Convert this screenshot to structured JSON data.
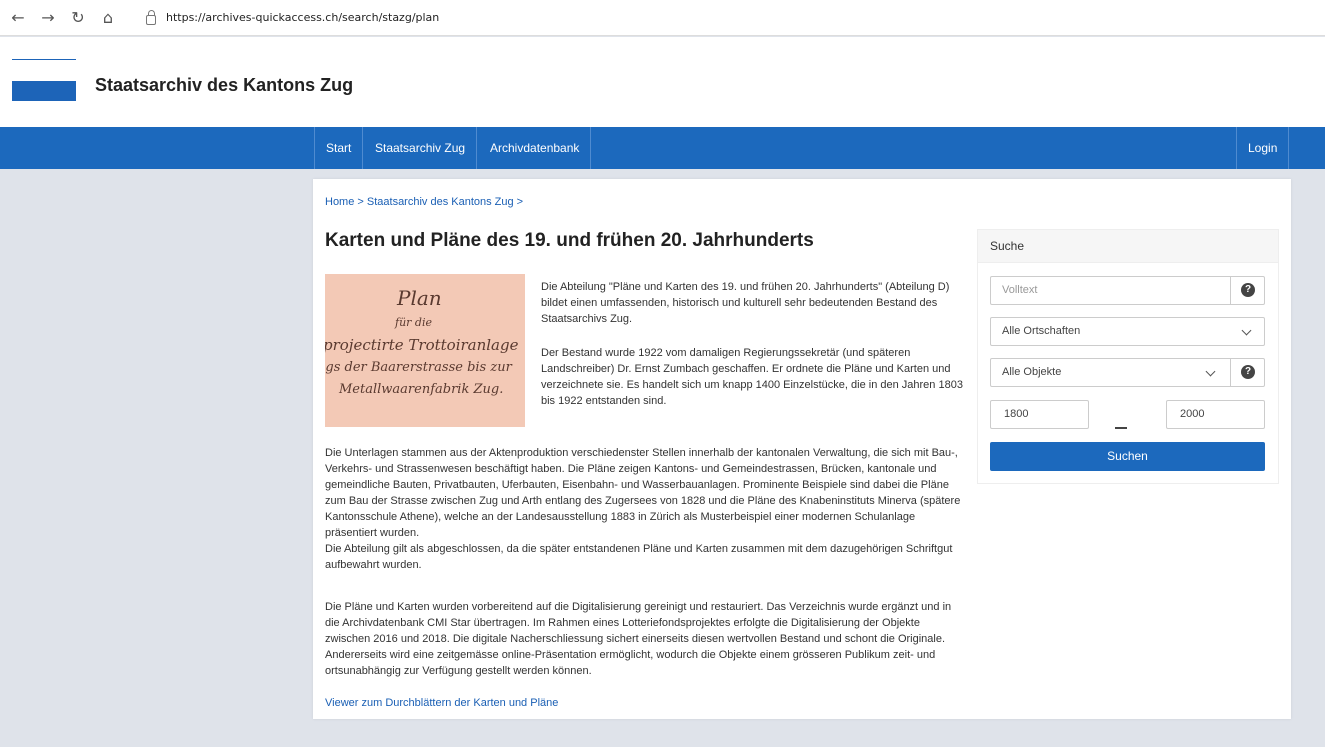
{
  "browser": {
    "back": "←",
    "forward": "→",
    "reload": "↻",
    "home": "⌂",
    "url": "https://archives-quickaccess.ch/search/stazg/plan"
  },
  "site": {
    "title": "Staatsarchiv des Kantons Zug",
    "accent_color": "#1c69bd"
  },
  "nav": {
    "items": [
      "Start",
      "Staatsarchiv Zug",
      "Archivdatenbank"
    ],
    "login": "Login"
  },
  "main": {
    "breadcrumb": "Home > Staatsarchiv des Kantons Zug >",
    "title": "Karten und Pläne des 19. und frühen 20. Jahrhunderts",
    "image_lines": [
      "Plan",
      "für die",
      "projectirte Trottoiranlage",
      "ngs der Baarerstrasse bis zur",
      "Metallwaarenfabrik Zug."
    ],
    "intro_1": "Die Abteilung \"Pläne und Karten des 19. und frühen 20. Jahrhunderts\" (Abteilung D) bildet einen umfassenden, historisch und kulturell sehr bedeutenden Bestand des Staatsarchivs Zug.",
    "intro_2": "Der Bestand wurde 1922 vom damaligen Regierungssekretär (und späteren Landschreiber) Dr. Ernst Zumbach geschaffen. Er ordnete die Pläne und Karten und verzeichnete sie. Es handelt sich um knapp 1400 Einzelstücke, die in den Jahren 1803 bis 1922 entstanden sind.",
    "body_1": "Die Unterlagen stammen aus der Aktenproduktion verschiedenster Stellen innerhalb der kantonalen Verwaltung, die sich mit Bau-, Verkehrs- und Strassenwesen beschäftigt haben. Die Pläne zeigen Kantons- und Gemeindestrassen, Brücken, kantonale und gemeindliche Bauten, Privatbauten, Uferbauten, Eisenbahn- und Wasserbauanlagen. Prominente Beispiele sind dabei die Pläne zum Bau der Strasse zwischen Zug und Arth entlang des Zugersees von 1828 und die Pläne des Knabeninstituts Minerva (spätere Kantonsschule Athene), welche an der Landesausstellung 1883 in Zürich als Musterbeispiel einer modernen Schulanlage präsentiert wurden.",
    "body_1b": "Die Abteilung gilt als abgeschlossen, da die später entstandenen Pläne und Karten zusammen mit dem dazugehörigen Schriftgut aufbewahrt wurden.",
    "body_2": "Die Pläne und Karten wurden vorbereitend auf die Digitalisierung gereinigt und restauriert. Das Verzeichnis wurde ergänzt und in die Archivdatenbank CMI Star übertragen. Im Rahmen eines Lotteriefondsprojektes erfolgte die Digitalisierung der Objekte zwischen 2016 und 2018. Die digitale Nacherschliessung sichert einerseits diesen wertvollen Bestand und schont die Originale. Andererseits wird eine zeitgemässe online-Präsentation ermöglicht, wodurch die Objekte einem grösseren Publikum zeit- und ortsunabhängig zur Verfügung gestellt werden können.",
    "viewer_link": "Viewer zum Durchblättern der Karten und Pläne"
  },
  "search": {
    "header": "Suche",
    "fulltext_placeholder": "Volltext",
    "help": "?",
    "ortschaften": "Alle Ortschaften",
    "objekte": "Alle Objekte",
    "year_from": "1800",
    "year_to": "2000",
    "button": "Suchen"
  }
}
